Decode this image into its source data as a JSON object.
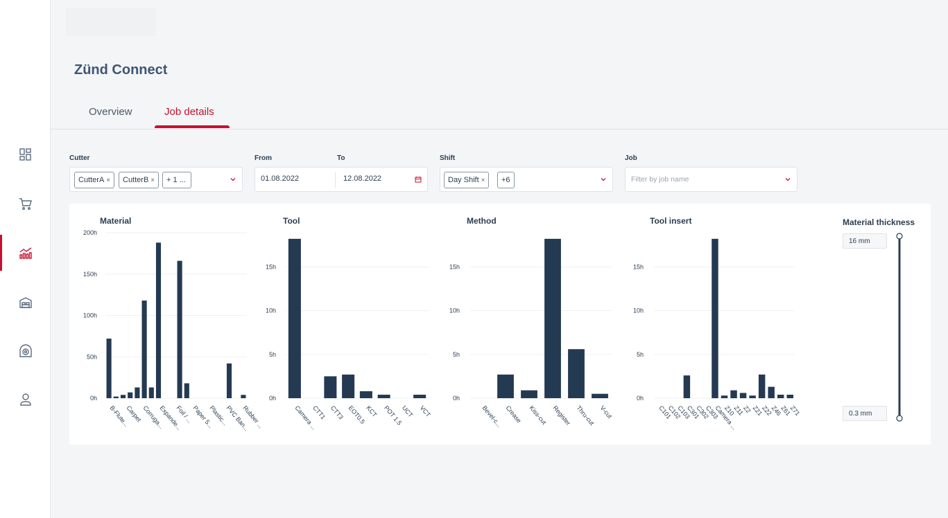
{
  "app": {
    "title": "Zünd Connect"
  },
  "tabs": [
    {
      "label": "Overview",
      "active": false
    },
    {
      "label": "Job details",
      "active": true
    }
  ],
  "sidebar": {
    "items": [
      {
        "icon": "dashboard-icon",
        "active": false
      },
      {
        "icon": "cart-icon",
        "active": false
      },
      {
        "icon": "analytics-chart-icon",
        "active": true
      },
      {
        "icon": "warehouse-icon",
        "active": false
      },
      {
        "icon": "cutter-device-icon",
        "active": false
      },
      {
        "icon": "user-icon",
        "active": false
      }
    ]
  },
  "filters": {
    "cutter": {
      "label": "Cutter",
      "chips": [
        "CutterA",
        "CutterB"
      ],
      "more": "+ 1 ..."
    },
    "from": {
      "label": "From",
      "value": "01.08.2022"
    },
    "to": {
      "label": "To",
      "value": "12.08.2022"
    },
    "shift": {
      "label": "Shift",
      "chips": [
        "Day Shift"
      ],
      "more": "+6"
    },
    "job": {
      "label": "Job",
      "placeholder": "Filter by job name"
    }
  },
  "material_thickness": {
    "label": "Material thickness",
    "max": "16 mm",
    "min": "0.3 mm"
  },
  "colors": {
    "accent": "#c8102e",
    "bar": "#233a52",
    "text": "#2b3d52"
  },
  "chart_data": [
    {
      "type": "bar",
      "title": "Material",
      "categories": [
        "B-Flute...",
        "",
        "Carpet",
        "",
        "Corruga...",
        "",
        "Expande...",
        "",
        "Foil / ...",
        "",
        "Paper 5...",
        "",
        "Plastic...",
        "",
        "PVC Ban...",
        "",
        "Rubber ..."
      ],
      "values": [
        72,
        2,
        4,
        7,
        13,
        118,
        13,
        188,
        0,
        0,
        166,
        18,
        0,
        0,
        0,
        0,
        0,
        42,
        0,
        4
      ],
      "bar_categories": 20,
      "yticks": [
        "0h",
        "50h",
        "100h",
        "150h",
        "200h"
      ],
      "ylim": [
        0,
        200
      ]
    },
    {
      "type": "bar",
      "title": "Tool",
      "categories": [
        "Camera ...",
        "CTT1",
        "CTT3",
        "EOT0.5",
        "KCT",
        "POT 1.5",
        "UCT",
        "VCT"
      ],
      "values": [
        18.2,
        0,
        2.5,
        2.7,
        0.8,
        0.4,
        0,
        0.4
      ],
      "yticks": [
        "0h",
        "5h",
        "10h",
        "15h"
      ],
      "ylim": [
        0,
        18.9
      ]
    },
    {
      "type": "bar",
      "title": "Method",
      "categories": [
        "Bevel-c...",
        "Crease",
        "Kiss-cut",
        "Register",
        "Thru-cut",
        "V-cut"
      ],
      "values": [
        0,
        2.7,
        0.9,
        18.2,
        5.6,
        0.5
      ],
      "yticks": [
        "0h",
        "5h",
        "10h",
        "15h"
      ],
      "ylim": [
        0,
        18.9
      ]
    },
    {
      "type": "bar",
      "title": "Tool insert",
      "categories": [
        "C101",
        "C102",
        "C103",
        "C301",
        "C302",
        "C303",
        "Camera ...",
        "Z10",
        "Z11",
        "Z2",
        "Z21",
        "Z22",
        "Z46",
        "Z61",
        "Z71"
      ],
      "values": [
        0,
        0,
        0,
        2.6,
        0,
        0,
        18.2,
        0.3,
        0.9,
        0.6,
        0.3,
        2.7,
        1.3,
        0.4,
        0.4
      ],
      "yticks": [
        "0h",
        "5h",
        "10h",
        "15h"
      ],
      "ylim": [
        0,
        18.9
      ]
    }
  ]
}
